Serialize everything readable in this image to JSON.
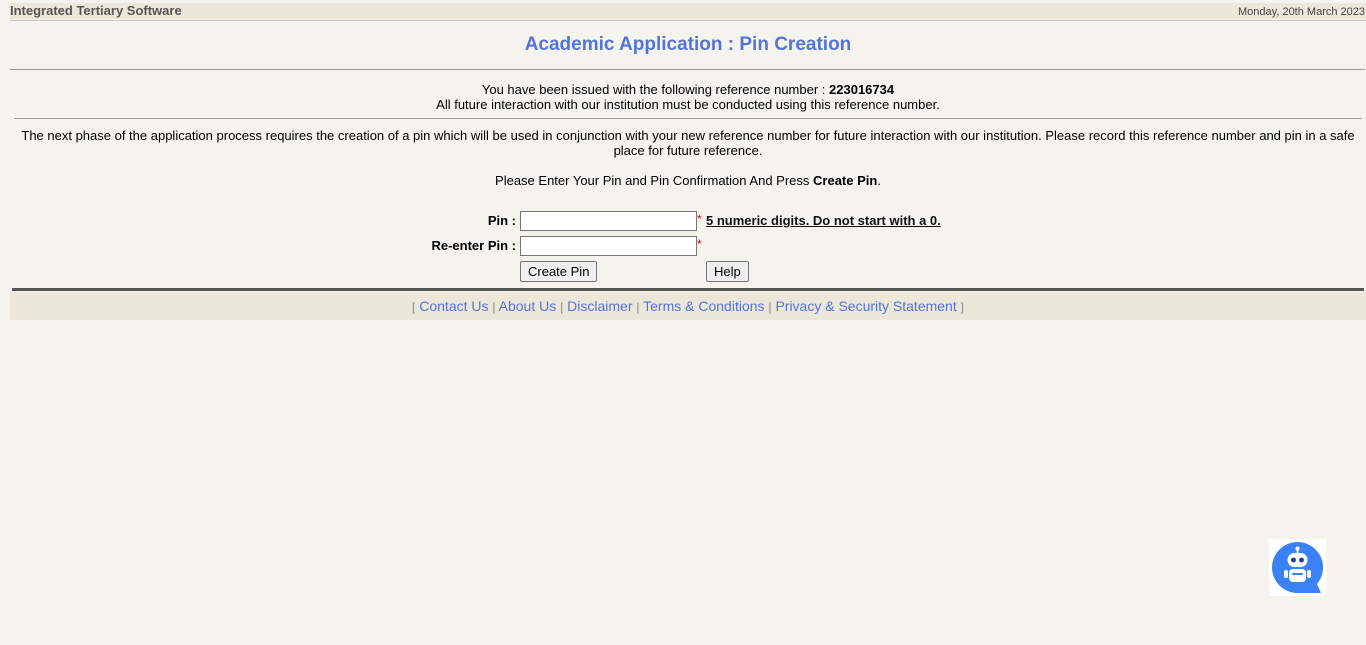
{
  "header": {
    "app_name": "Integrated Tertiary Software",
    "date": "Monday, 20th March 2023"
  },
  "page_title": "Academic Application : Pin Creation",
  "reference": {
    "issued_text": "You have been issued with the following reference number :",
    "number": "223016734",
    "note": "All future interaction with our institution must be conducted using this reference number."
  },
  "info_paragraph": "The next phase of the application process requires the creation of a pin which will be used in conjunction with your new reference number for future interaction with our institution. Please record this reference number and pin in a safe place for future reference.",
  "instruction": {
    "prefix": "Please Enter Your Pin and Pin Confirmation And Press",
    "action": "Create Pin",
    "suffix": "."
  },
  "form": {
    "pin_label": "Pin :",
    "pin_value": "",
    "reenter_label": "Re-enter Pin :",
    "reenter_value": "",
    "required_mark": "*",
    "pin_hint": "5 numeric digits. Do not start with a 0.",
    "create_button": "Create Pin",
    "help_button": "Help"
  },
  "footer": {
    "open_bracket": "[",
    "close_bracket": "]",
    "separator": "|",
    "links": [
      "Contact Us",
      "About Us",
      "Disclaimer",
      "Terms & Conditions",
      "Privacy & Security Statement"
    ]
  },
  "chatbot": {
    "icon": "robot-chat-icon",
    "color": "#3b82f6"
  }
}
